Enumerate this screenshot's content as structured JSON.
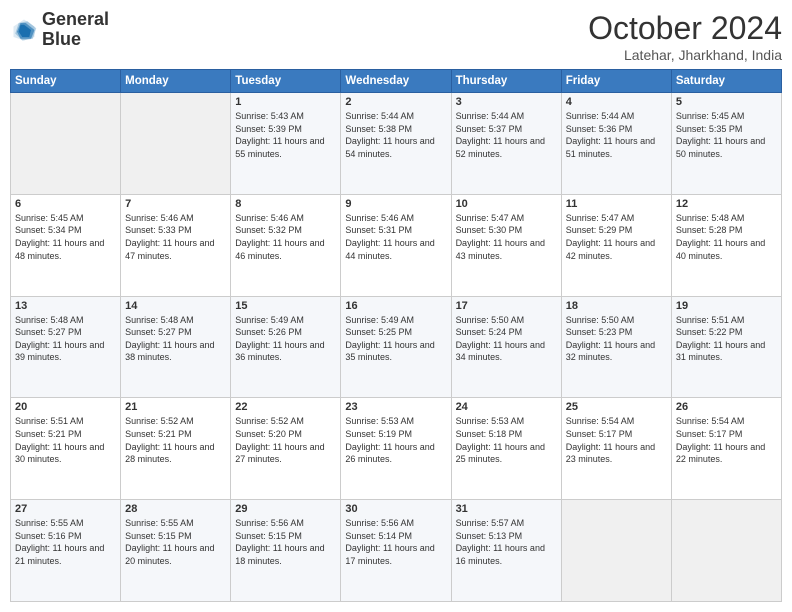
{
  "logo": {
    "line1": "General",
    "line2": "Blue"
  },
  "title": "October 2024",
  "subtitle": "Latehar, Jharkhand, India",
  "days_of_week": [
    "Sunday",
    "Monday",
    "Tuesday",
    "Wednesday",
    "Thursday",
    "Friday",
    "Saturday"
  ],
  "weeks": [
    [
      {
        "day": "",
        "sunrise": "",
        "sunset": "",
        "daylight": ""
      },
      {
        "day": "",
        "sunrise": "",
        "sunset": "",
        "daylight": ""
      },
      {
        "day": "1",
        "sunrise": "Sunrise: 5:43 AM",
        "sunset": "Sunset: 5:39 PM",
        "daylight": "Daylight: 11 hours and 55 minutes."
      },
      {
        "day": "2",
        "sunrise": "Sunrise: 5:44 AM",
        "sunset": "Sunset: 5:38 PM",
        "daylight": "Daylight: 11 hours and 54 minutes."
      },
      {
        "day": "3",
        "sunrise": "Sunrise: 5:44 AM",
        "sunset": "Sunset: 5:37 PM",
        "daylight": "Daylight: 11 hours and 52 minutes."
      },
      {
        "day": "4",
        "sunrise": "Sunrise: 5:44 AM",
        "sunset": "Sunset: 5:36 PM",
        "daylight": "Daylight: 11 hours and 51 minutes."
      },
      {
        "day": "5",
        "sunrise": "Sunrise: 5:45 AM",
        "sunset": "Sunset: 5:35 PM",
        "daylight": "Daylight: 11 hours and 50 minutes."
      }
    ],
    [
      {
        "day": "6",
        "sunrise": "Sunrise: 5:45 AM",
        "sunset": "Sunset: 5:34 PM",
        "daylight": "Daylight: 11 hours and 48 minutes."
      },
      {
        "day": "7",
        "sunrise": "Sunrise: 5:46 AM",
        "sunset": "Sunset: 5:33 PM",
        "daylight": "Daylight: 11 hours and 47 minutes."
      },
      {
        "day": "8",
        "sunrise": "Sunrise: 5:46 AM",
        "sunset": "Sunset: 5:32 PM",
        "daylight": "Daylight: 11 hours and 46 minutes."
      },
      {
        "day": "9",
        "sunrise": "Sunrise: 5:46 AM",
        "sunset": "Sunset: 5:31 PM",
        "daylight": "Daylight: 11 hours and 44 minutes."
      },
      {
        "day": "10",
        "sunrise": "Sunrise: 5:47 AM",
        "sunset": "Sunset: 5:30 PM",
        "daylight": "Daylight: 11 hours and 43 minutes."
      },
      {
        "day": "11",
        "sunrise": "Sunrise: 5:47 AM",
        "sunset": "Sunset: 5:29 PM",
        "daylight": "Daylight: 11 hours and 42 minutes."
      },
      {
        "day": "12",
        "sunrise": "Sunrise: 5:48 AM",
        "sunset": "Sunset: 5:28 PM",
        "daylight": "Daylight: 11 hours and 40 minutes."
      }
    ],
    [
      {
        "day": "13",
        "sunrise": "Sunrise: 5:48 AM",
        "sunset": "Sunset: 5:27 PM",
        "daylight": "Daylight: 11 hours and 39 minutes."
      },
      {
        "day": "14",
        "sunrise": "Sunrise: 5:48 AM",
        "sunset": "Sunset: 5:27 PM",
        "daylight": "Daylight: 11 hours and 38 minutes."
      },
      {
        "day": "15",
        "sunrise": "Sunrise: 5:49 AM",
        "sunset": "Sunset: 5:26 PM",
        "daylight": "Daylight: 11 hours and 36 minutes."
      },
      {
        "day": "16",
        "sunrise": "Sunrise: 5:49 AM",
        "sunset": "Sunset: 5:25 PM",
        "daylight": "Daylight: 11 hours and 35 minutes."
      },
      {
        "day": "17",
        "sunrise": "Sunrise: 5:50 AM",
        "sunset": "Sunset: 5:24 PM",
        "daylight": "Daylight: 11 hours and 34 minutes."
      },
      {
        "day": "18",
        "sunrise": "Sunrise: 5:50 AM",
        "sunset": "Sunset: 5:23 PM",
        "daylight": "Daylight: 11 hours and 32 minutes."
      },
      {
        "day": "19",
        "sunrise": "Sunrise: 5:51 AM",
        "sunset": "Sunset: 5:22 PM",
        "daylight": "Daylight: 11 hours and 31 minutes."
      }
    ],
    [
      {
        "day": "20",
        "sunrise": "Sunrise: 5:51 AM",
        "sunset": "Sunset: 5:21 PM",
        "daylight": "Daylight: 11 hours and 30 minutes."
      },
      {
        "day": "21",
        "sunrise": "Sunrise: 5:52 AM",
        "sunset": "Sunset: 5:21 PM",
        "daylight": "Daylight: 11 hours and 28 minutes."
      },
      {
        "day": "22",
        "sunrise": "Sunrise: 5:52 AM",
        "sunset": "Sunset: 5:20 PM",
        "daylight": "Daylight: 11 hours and 27 minutes."
      },
      {
        "day": "23",
        "sunrise": "Sunrise: 5:53 AM",
        "sunset": "Sunset: 5:19 PM",
        "daylight": "Daylight: 11 hours and 26 minutes."
      },
      {
        "day": "24",
        "sunrise": "Sunrise: 5:53 AM",
        "sunset": "Sunset: 5:18 PM",
        "daylight": "Daylight: 11 hours and 25 minutes."
      },
      {
        "day": "25",
        "sunrise": "Sunrise: 5:54 AM",
        "sunset": "Sunset: 5:17 PM",
        "daylight": "Daylight: 11 hours and 23 minutes."
      },
      {
        "day": "26",
        "sunrise": "Sunrise: 5:54 AM",
        "sunset": "Sunset: 5:17 PM",
        "daylight": "Daylight: 11 hours and 22 minutes."
      }
    ],
    [
      {
        "day": "27",
        "sunrise": "Sunrise: 5:55 AM",
        "sunset": "Sunset: 5:16 PM",
        "daylight": "Daylight: 11 hours and 21 minutes."
      },
      {
        "day": "28",
        "sunrise": "Sunrise: 5:55 AM",
        "sunset": "Sunset: 5:15 PM",
        "daylight": "Daylight: 11 hours and 20 minutes."
      },
      {
        "day": "29",
        "sunrise": "Sunrise: 5:56 AM",
        "sunset": "Sunset: 5:15 PM",
        "daylight": "Daylight: 11 hours and 18 minutes."
      },
      {
        "day": "30",
        "sunrise": "Sunrise: 5:56 AM",
        "sunset": "Sunset: 5:14 PM",
        "daylight": "Daylight: 11 hours and 17 minutes."
      },
      {
        "day": "31",
        "sunrise": "Sunrise: 5:57 AM",
        "sunset": "Sunset: 5:13 PM",
        "daylight": "Daylight: 11 hours and 16 minutes."
      },
      {
        "day": "",
        "sunrise": "",
        "sunset": "",
        "daylight": ""
      },
      {
        "day": "",
        "sunrise": "",
        "sunset": "",
        "daylight": ""
      }
    ]
  ]
}
